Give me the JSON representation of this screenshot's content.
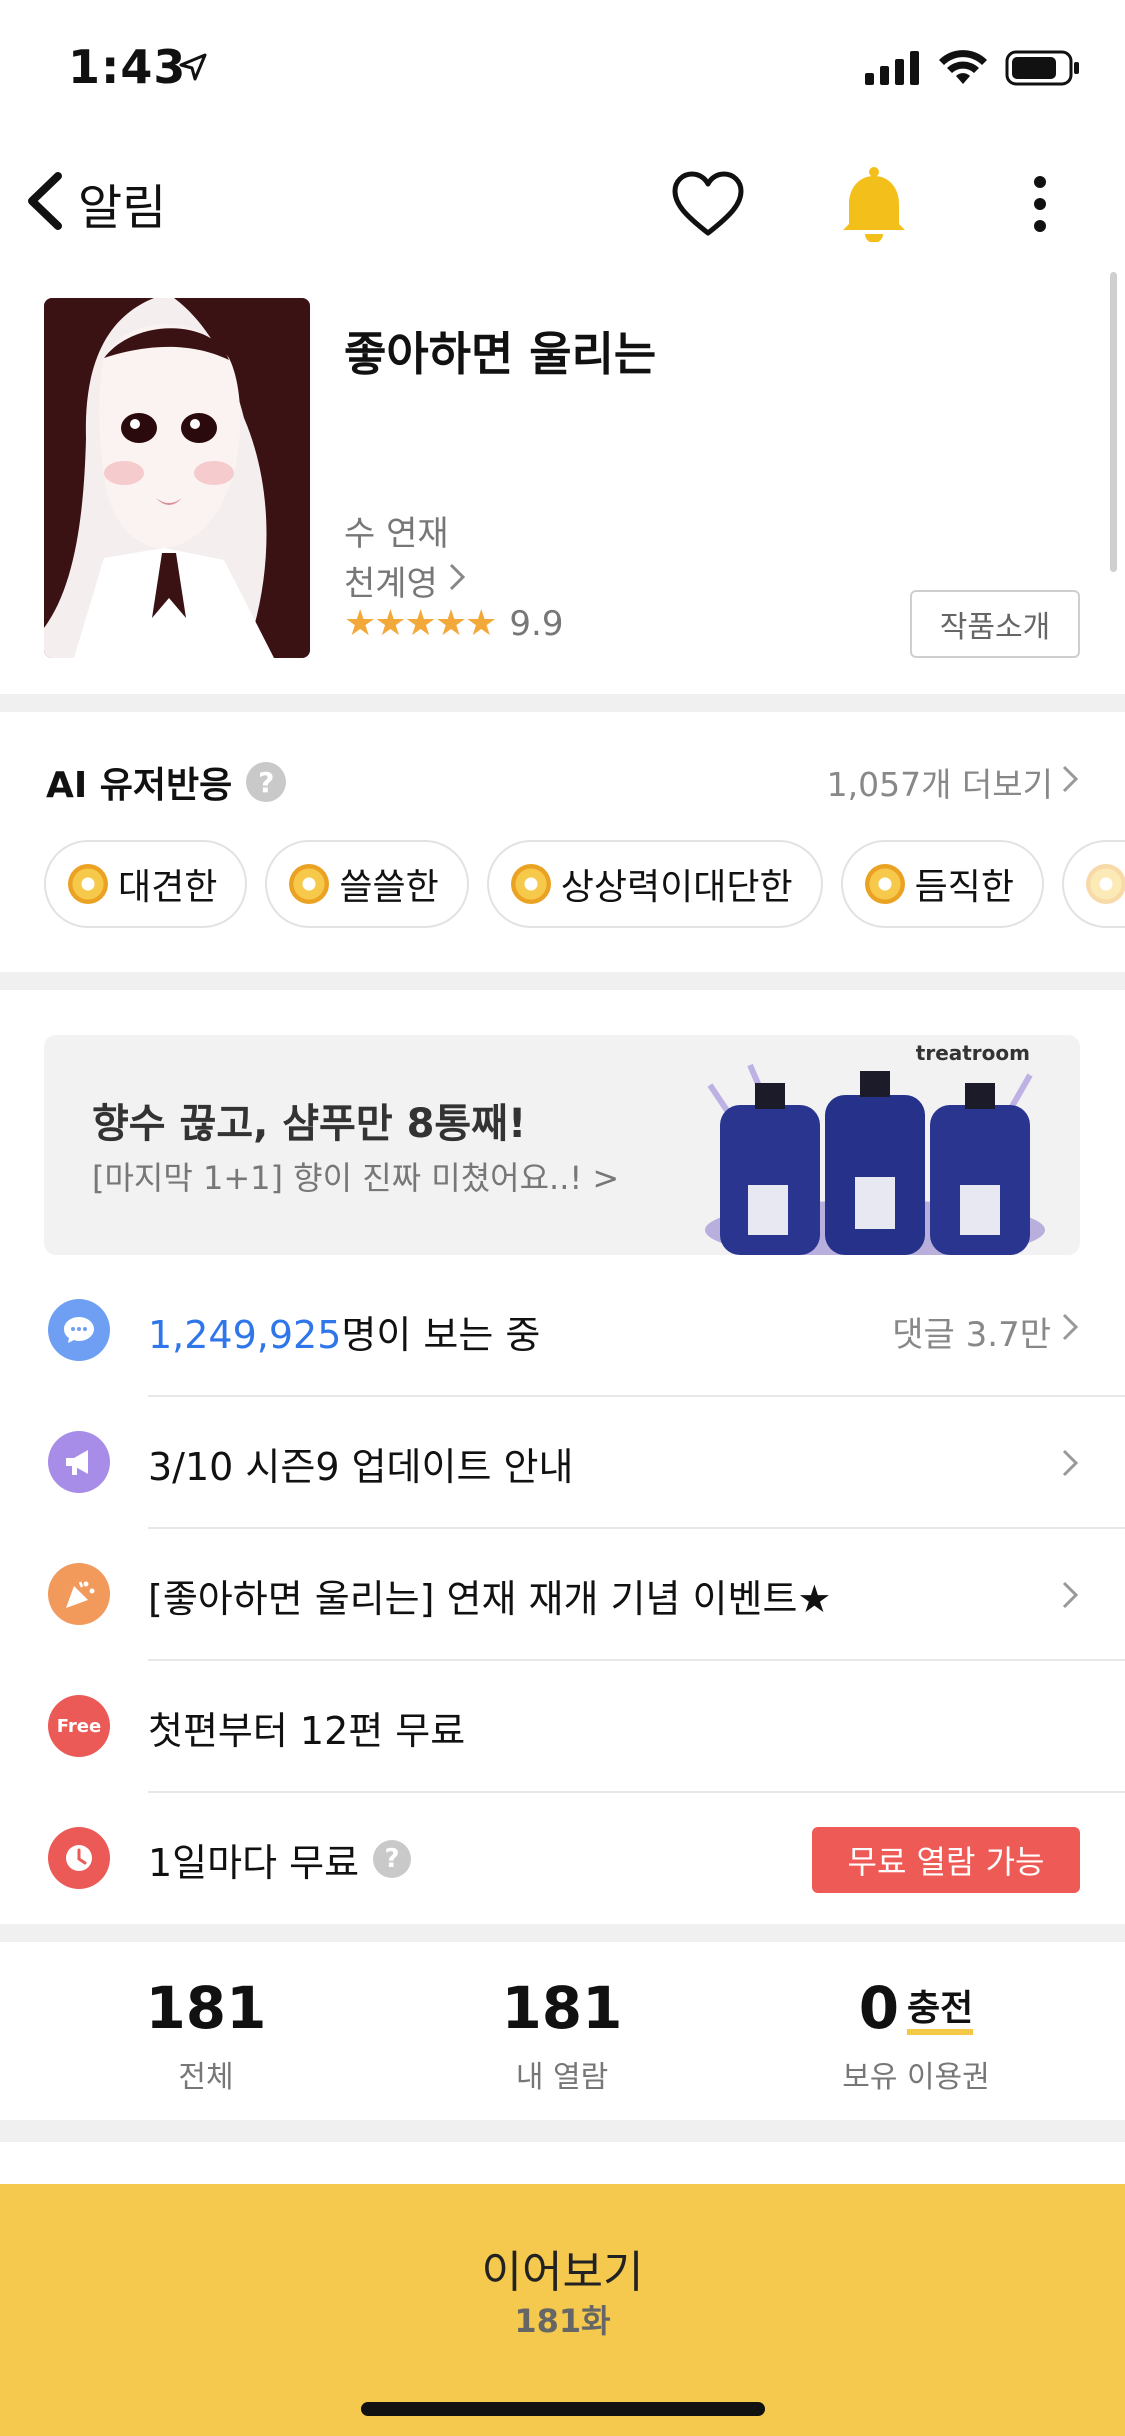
{
  "status_bar": {
    "time": "1:43"
  },
  "nav": {
    "back_label": "알림"
  },
  "work": {
    "title": "좋아하면 울리는",
    "status": "수 연재",
    "author": "천계영",
    "stars": "★★★★★",
    "rating": "9.9",
    "intro_button": "작품소개"
  },
  "ai_reactions": {
    "title": "AI 유저반응",
    "help": "?",
    "more": "1,057개 더보기",
    "chips": [
      "대견한",
      "쓸쓸한",
      "상상력이대단한",
      "듬직한"
    ]
  },
  "ad": {
    "title": "향수 끊고, 샴푸만 8통째!",
    "subtitle": "[마지막 1+1] 향이 진짜 미쳤어요..! >",
    "brand": "treatroom"
  },
  "info": {
    "viewers_count": "1,249,925",
    "viewers_suffix": "명이 보는 중",
    "comments": "댓글 3.7만",
    "notice": "3/10 시즌9 업데이트 안내",
    "event": "[좋아하면 울리는] 연재 재개 기념 이벤트★",
    "free_badge": "Free",
    "free_episodes": "첫편부터 12편 무료",
    "daily_free": "1일마다 무료",
    "daily_help": "?",
    "free_read_button": "무료 열람 가능"
  },
  "stats": {
    "total": "181",
    "total_label": "전체",
    "read": "181",
    "read_label": "내 열람",
    "tickets": "0",
    "charge": "충전",
    "tickets_label": "보유 이용권"
  },
  "cta": {
    "label": "이어보기",
    "episode": "181화"
  },
  "colors": {
    "accent_yellow": "#f5c94e",
    "link_blue": "#2f76ea",
    "free_red": "#ee5a55",
    "star_orange": "#f3a93a"
  }
}
